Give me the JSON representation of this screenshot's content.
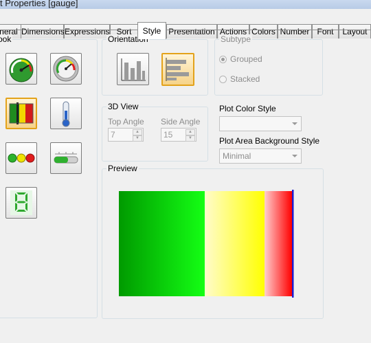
{
  "window": {
    "title": "t Properties [gauge]"
  },
  "tabs": [
    {
      "label": "neral"
    },
    {
      "label": "Dimensions"
    },
    {
      "label": "Expressions"
    },
    {
      "label": "Sort"
    },
    {
      "label": "Style"
    },
    {
      "label": "Presentation"
    },
    {
      "label": "Actions"
    },
    {
      "label": "Colors"
    },
    {
      "label": "Number"
    },
    {
      "label": "Font"
    },
    {
      "label": "Layout"
    }
  ],
  "active_tab": "Style",
  "look": {
    "legend": "ook",
    "options": [
      {
        "icon": "speedometer-gauge-icon",
        "selected": false
      },
      {
        "icon": "round-dial-gauge-icon",
        "selected": false
      },
      {
        "icon": "linear-bar-gauge-icon",
        "selected": true
      },
      {
        "icon": "thermometer-gauge-icon",
        "selected": false
      },
      {
        "icon": "traffic-light-gauge-icon",
        "selected": false
      },
      {
        "icon": "progress-slider-gauge-icon",
        "selected": false
      },
      {
        "icon": "digital-led-gauge-icon",
        "selected": false
      }
    ]
  },
  "orientation": {
    "legend": "Orientation",
    "options": [
      {
        "icon": "vertical-bars-icon",
        "selected": false
      },
      {
        "icon": "horizontal-bars-icon",
        "selected": true
      }
    ]
  },
  "subtype": {
    "legend": "Subtype",
    "options": [
      {
        "label": "Grouped",
        "checked": true
      },
      {
        "label": "Stacked",
        "checked": false
      }
    ]
  },
  "view3d": {
    "legend": "3D View",
    "top_angle_label": "Top Angle",
    "top_angle_value": "7",
    "side_angle_label": "Side Angle",
    "side_angle_value": "15"
  },
  "plot_color_style": {
    "label": "Plot Color Style",
    "value": ""
  },
  "plot_area_bg": {
    "label": "Plot Area Background Style",
    "value": "Minimal"
  },
  "preview": {
    "legend": "Preview",
    "segments": [
      {
        "from": "#009a00",
        "to": "#14ff14",
        "share": 0.496
      },
      {
        "from": "#fffccc",
        "to": "#ffff00",
        "share": 0.346
      },
      {
        "from": "#ffcccc",
        "to": "#ff0000",
        "share": 0.158
      }
    ],
    "marker_color": "#1c1cd0"
  }
}
